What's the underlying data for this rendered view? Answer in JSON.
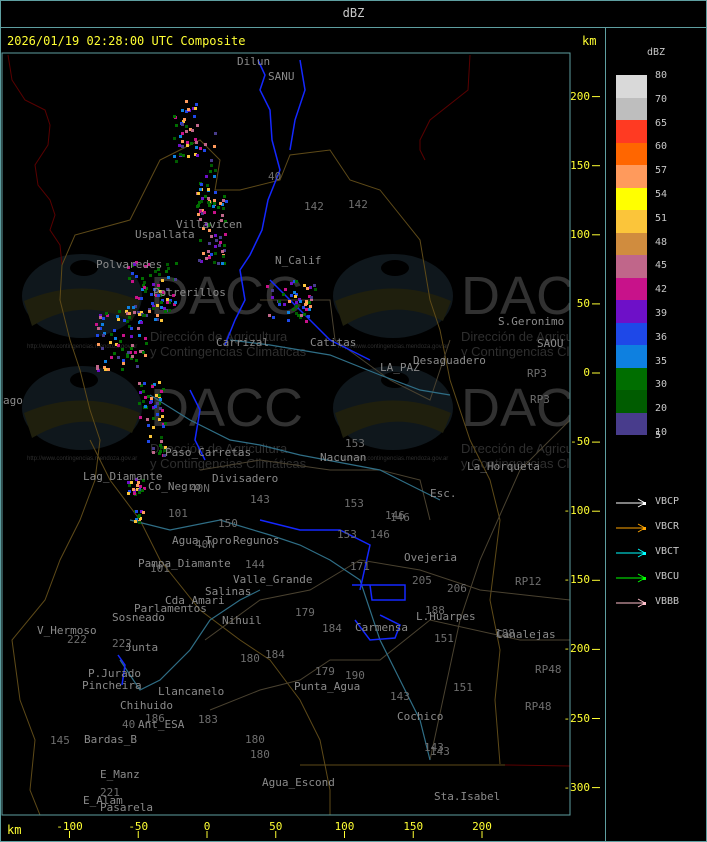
{
  "header": {
    "title": "dBZ"
  },
  "map": {
    "timestamp": "2026/01/19 02:28:00 UTC Composite",
    "unit_top": "km",
    "unit_bottom": "km",
    "x_ticks": [
      -100,
      -50,
      0,
      50,
      100,
      150,
      200
    ],
    "y_ticks": [
      200,
      150,
      100,
      50,
      0,
      -50,
      -100,
      -150,
      -200,
      -250,
      -300
    ],
    "places": [
      "Dilun",
      "SANU",
      "Villavicen",
      "Uspallata",
      "Polvaredes",
      "N_Calif",
      "Potrerillos",
      "Carrizal",
      "Catitas",
      "S.Geronimo",
      "SAOU",
      "Desaguadero",
      "LA_PAZ",
      "Nacunan",
      "La_Horqueta",
      "Paso_Carretas",
      "Lag_Diamante",
      "Co_Negro",
      "Divisadero",
      "Esc.",
      "Agua_Toro",
      "Pampa_Diamante",
      "Valle_Grande",
      "Salinas",
      "Cda_Amari",
      "Parlamentos",
      "Sosneado",
      "V_Hermoso",
      "Junta",
      "Nihuil",
      "P.Jurado",
      "Pincheira",
      "Llancanelo",
      "Chihuido",
      "Ant_ESA",
      "Bardas_B",
      "E_Manz",
      "E_Alam",
      "Pasarela",
      "Agua_Escond",
      "Punta_Agua",
      "Cochico",
      "Sta.Isabel",
      "Ovejeria",
      "L.Huarpes",
      "Canalejas",
      "Carmensa",
      "ago",
      "Regunos"
    ],
    "routes": [
      "40",
      "142",
      "142",
      "153",
      "153",
      "153",
      "146",
      "146",
      "143",
      "150",
      "101",
      "101",
      "40N",
      "40N",
      "144",
      "180",
      "184",
      "184",
      "179",
      "179",
      "190",
      "171",
      "205",
      "206",
      "188",
      "188",
      "151",
      "151",
      "143",
      "143",
      "143",
      "RP3",
      "RP3",
      "RP12",
      "RP48",
      "RP48",
      "222",
      "222",
      "145",
      "186",
      "183",
      "180",
      "221",
      "180",
      "40",
      "146"
    ],
    "watermark": {
      "logo_text": "DACC",
      "line1": "Dirección de Agricultura",
      "line2": "y Contingencias Climáticas",
      "url": "http://www.contingencias.mendoza.gov.ar"
    }
  },
  "legend": {
    "title": "dBZ",
    "scale": [
      {
        "label": "80",
        "color": "#d9d9d9"
      },
      {
        "label": "70",
        "color": "#bebebe"
      },
      {
        "label": "65",
        "color": "#ff3a22"
      },
      {
        "label": "60",
        "color": "#ff6600"
      },
      {
        "label": "57",
        "color": "#ff9a5c"
      },
      {
        "label": "54",
        "color": "#ffff00"
      },
      {
        "label": "51",
        "color": "#fbc53a"
      },
      {
        "label": "48",
        "color": "#d08c3e"
      },
      {
        "label": "45",
        "color": "#c0668a"
      },
      {
        "label": "42",
        "color": "#c8128a"
      },
      {
        "label": "39",
        "color": "#6e10c8"
      },
      {
        "label": "36",
        "color": "#1e48e8"
      },
      {
        "label": "35",
        "color": "#0e80e0"
      },
      {
        "label": "30",
        "color": "#006e00"
      },
      {
        "label": "20",
        "color": "#005c00"
      },
      {
        "label": "10",
        "color": "#483c8c"
      }
    ],
    "bottom_label": "5",
    "radars": [
      {
        "name": "VBCP",
        "color": "#ffffff"
      },
      {
        "name": "VBCR",
        "color": "#ffa500"
      },
      {
        "name": "VBCT",
        "color": "#00ffff"
      },
      {
        "name": "VBCU",
        "color": "#00ff00"
      },
      {
        "name": "VBBB",
        "color": "#ffc0cb"
      }
    ]
  }
}
